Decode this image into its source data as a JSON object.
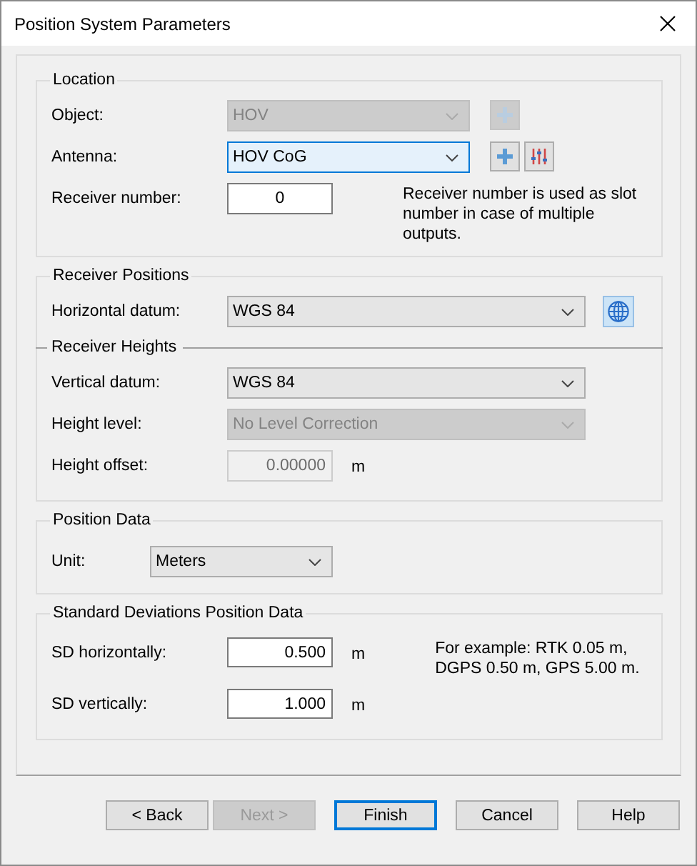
{
  "window": {
    "title": "Position System Parameters"
  },
  "groups": [
    {
      "title": "Location",
      "rows": [
        {
          "kind": "combo",
          "label": "Object:",
          "value": "HOV",
          "disabled": true,
          "focused": false,
          "tools": [
            {
              "kind": "plus",
              "disabled": true
            }
          ]
        },
        {
          "kind": "combo",
          "label": "Antenna:",
          "value": "HOV CoG",
          "disabled": false,
          "focused": true,
          "tools": [
            {
              "kind": "plus",
              "disabled": false
            },
            {
              "kind": "sliders",
              "disabled": false
            }
          ]
        },
        {
          "kind": "input",
          "label": "Receiver number:",
          "value": "0",
          "disabled": false,
          "note": "Receiver number is used as slot number in case of multiple outputs."
        }
      ]
    },
    {
      "title": "Receiver Positions",
      "rows": [
        {
          "kind": "combo",
          "label": "Horizontal datum:",
          "value": "WGS 84",
          "disabled": false,
          "focused": false,
          "tools": [
            {
              "kind": "globe",
              "disabled": false
            }
          ]
        },
        {
          "kind": "heading",
          "text": "Receiver Heights"
        },
        {
          "kind": "combo",
          "label": "Vertical datum:",
          "value": "WGS 84",
          "disabled": false,
          "focused": false
        },
        {
          "kind": "combo",
          "label": "Height level:",
          "value": "No Level Correction",
          "disabled": true,
          "focused": false
        },
        {
          "kind": "input",
          "label": "Height offset:",
          "value": "0.00000",
          "disabled": true,
          "unit": "m"
        }
      ]
    },
    {
      "title": "Position Data",
      "rows": [
        {
          "kind": "combo",
          "label": "Unit:",
          "value": "Meters",
          "disabled": false,
          "focused": false
        }
      ]
    },
    {
      "title": "Standard Deviations Position Data",
      "rows": [
        {
          "kind": "input",
          "label": "SD horizontally:",
          "value": "0.500",
          "disabled": false,
          "unit": "m",
          "note": "For example: RTK 0.05 m, DGPS 0.50 m, GPS 5.00 m."
        },
        {
          "kind": "input",
          "label": "SD vertically:",
          "value": "1.000",
          "disabled": false,
          "unit": "m"
        }
      ]
    }
  ],
  "buttons": [
    {
      "label": "< Back",
      "disabled": false,
      "focused": false
    },
    {
      "label": "Next >",
      "disabled": true,
      "focused": false
    },
    {
      "label": "Finish",
      "disabled": false,
      "focused": true
    },
    {
      "label": "Cancel",
      "disabled": false,
      "focused": false
    },
    {
      "label": "Help",
      "disabled": false,
      "focused": false
    }
  ]
}
